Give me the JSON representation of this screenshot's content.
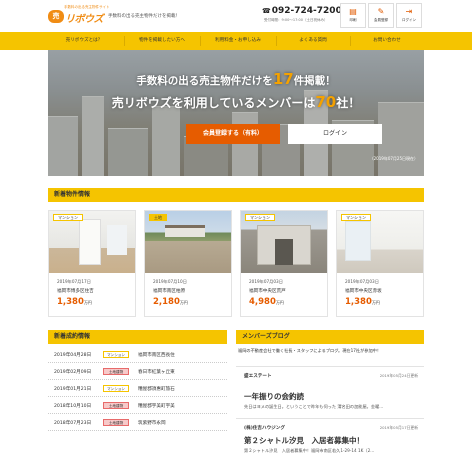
{
  "header": {
    "logo_badge": "売",
    "logo_text": "リボウズ",
    "logo_tagline": "手数料の出る売主物件サイト",
    "tagline": "手数料の出る売主物件だけを掲載！",
    "phone": "092-724-7200",
    "hours": "受付時間：9:00〜17:00（土日祝休み）",
    "buttons": [
      {
        "icon": "print-icon",
        "label": "印刷"
      },
      {
        "icon": "member-icon",
        "label": "会員登録"
      },
      {
        "icon": "login-icon",
        "label": "ログイン"
      }
    ]
  },
  "nav": {
    "items": [
      "売リボウズとは？",
      "物件を掲載したい方へ",
      "利用料金・お申し込み",
      "よくある質問",
      "お問い合わせ"
    ]
  },
  "hero": {
    "line1_pre": "手数料の出る売主物件だけを",
    "line1_num": "17",
    "line1_post": "件掲載！",
    "line2_pre": "売リボウズを利用しているメンバーは",
    "line2_num": "70",
    "line2_post": "社！",
    "signup_label": "会員登録する（有料）",
    "login_label": "ログイン",
    "note": "（2019年07月25日現在）"
  },
  "new_listings": {
    "title": "新着物件情報",
    "cards": [
      {
        "tag": "マンション",
        "type": "mansion",
        "date": "2019年07月17日",
        "address": "福岡市博多区住吉",
        "price": "1,380",
        "unit": "万円"
      },
      {
        "tag": "土地",
        "type": "land",
        "date": "2019年07月10日",
        "address": "福岡市南区柏原",
        "price": "2,180",
        "unit": "万円"
      },
      {
        "tag": "マンション",
        "type": "mansion",
        "date": "2019年07月03日",
        "address": "福岡市中央区荒戸",
        "price": "4,980",
        "unit": "万円"
      },
      {
        "tag": "マンション",
        "type": "mansion",
        "date": "2019年07月03日",
        "address": "福岡市中央区赤坂",
        "price": "1,380",
        "unit": "万円"
      }
    ]
  },
  "closed": {
    "title": "新着成約情報",
    "rows": [
      {
        "date": "2019年04月28日",
        "tag": "マンション",
        "type": "mansion",
        "area": "福岡市南区西長住"
      },
      {
        "date": "2019年02月09日",
        "tag": "土地建物",
        "type": "house",
        "area": "春日市紅葉ヶ丘東"
      },
      {
        "date": "2019年01月21日",
        "tag": "マンション",
        "type": "mansion",
        "area": "糟屋郡須惠町旅石"
      },
      {
        "date": "2018年10月10日",
        "tag": "土地建物",
        "type": "house",
        "area": "糟屋郡宇美町宇美"
      },
      {
        "date": "2018年07月23日",
        "tag": "土地建物",
        "type": "house",
        "area": "筑紫野市永岡"
      }
    ]
  },
  "blog": {
    "title": "メンバーズブログ",
    "intro": "福岡の不動産会社で働く社長・スタッフによるブログ。現在17社が参加中！",
    "entries": [
      {
        "author": "盛エステート",
        "date": "2019年05月24日更新",
        "title": "一年振りの会釣読",
        "excerpt": "先日はヨメの誕生日。ということで昨年も伺った 渭名田の加能屋。金曜..."
      },
      {
        "author": "(株)住吉ハウジング",
        "date": "2019年05月17日更新",
        "title": "第２シャトル汐見　入居者募集中！",
        "excerpt": "第２シャトル汐見　入居者募集中！福岡市南区若久1-29-14 1K（2..."
      }
    ]
  },
  "colors": {
    "brand_yellow": "#f5c400",
    "accent_orange": "#e65c00"
  }
}
